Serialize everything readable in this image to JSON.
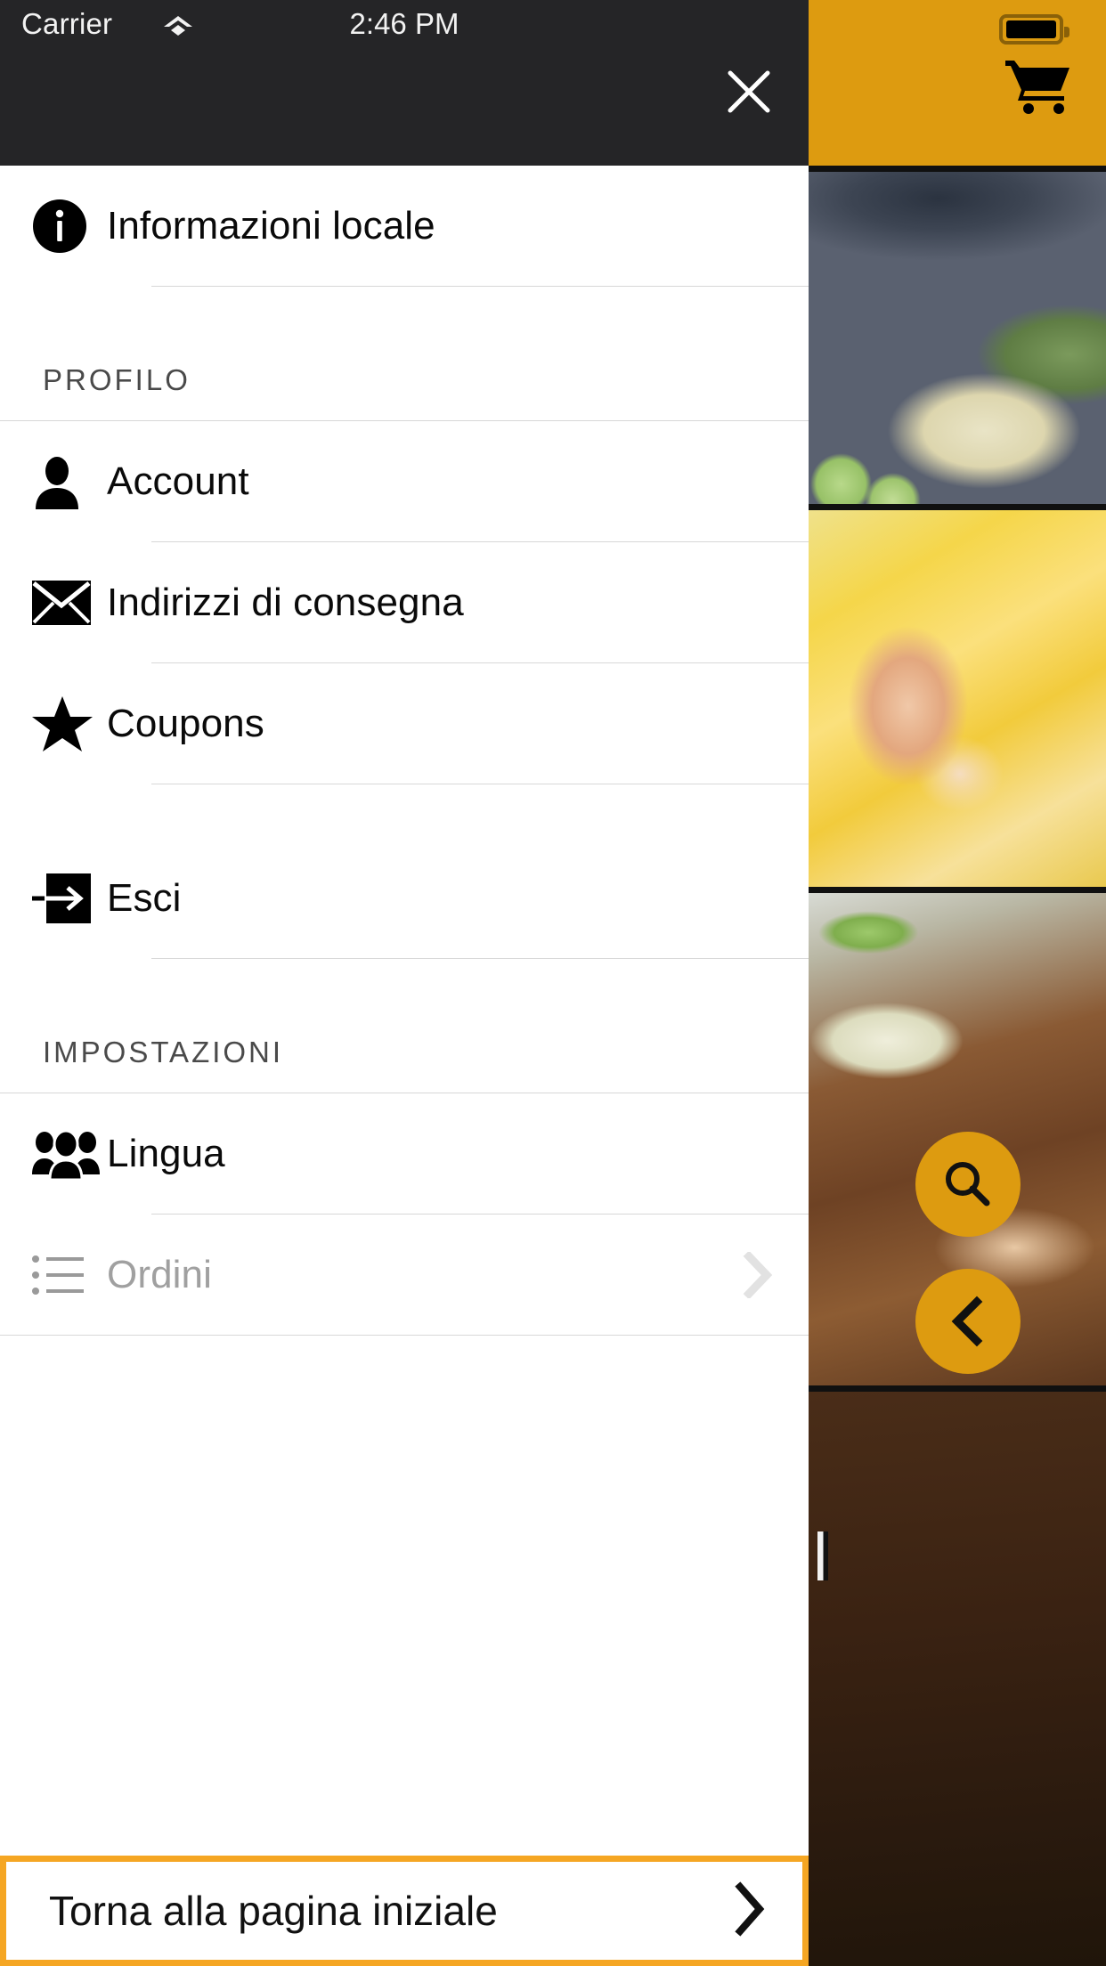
{
  "status_bar": {
    "carrier": "Carrier",
    "time": "2:46 PM",
    "wifi_icon": "wifi-icon",
    "battery_icon": "battery-icon"
  },
  "drawer": {
    "close_icon": "close-icon",
    "top_item": {
      "label": "Informazioni locale",
      "icon": "info-circle-icon"
    },
    "sections": [
      {
        "title": "PROFILO",
        "items": [
          {
            "label": "Account",
            "icon": "person-icon",
            "disabled": false,
            "chevron": false
          },
          {
            "label": "Indirizzi di consegna",
            "icon": "envelope-icon",
            "disabled": false,
            "chevron": false
          },
          {
            "label": "Coupons",
            "icon": "star-icon",
            "disabled": false,
            "chevron": false
          },
          {
            "label": "Esci",
            "icon": "exit-icon",
            "disabled": false,
            "chevron": false
          }
        ]
      },
      {
        "title": "IMPOSTAZIONI",
        "items": [
          {
            "label": "Lingua",
            "icon": "people-group-icon",
            "disabled": false,
            "chevron": false
          },
          {
            "label": "Ordini",
            "icon": "list-icon",
            "disabled": true,
            "chevron": true
          }
        ]
      }
    ],
    "home_button": {
      "label": "Torna alla pagina iniziale",
      "chevron_icon": "chevron-right-icon"
    }
  },
  "background_app": {
    "cart_icon": "shopping-cart-icon",
    "fab_search_icon": "search-icon",
    "fab_back_icon": "chevron-left-icon"
  },
  "colors": {
    "accent": "#dd9b10",
    "button_border": "#f5a623",
    "header_bar": "#252527",
    "text_primary": "#0a0a0a",
    "text_dim": "#a0a0a0",
    "divider": "#d8d8d8"
  }
}
